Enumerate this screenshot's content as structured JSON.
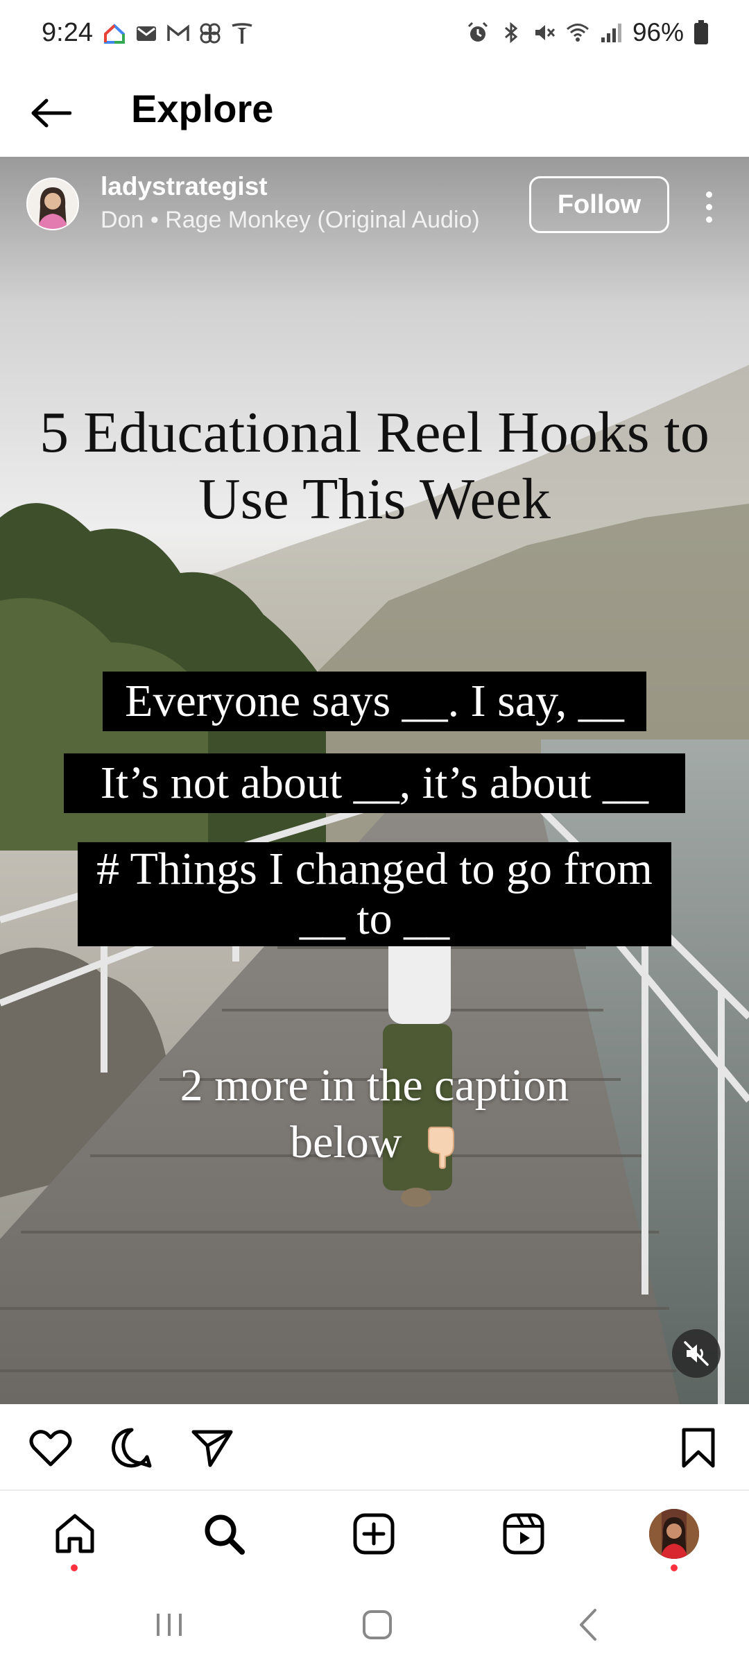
{
  "status_bar": {
    "time": "9:24",
    "battery": "96%",
    "left_icons": [
      "google-home-icon",
      "mail-icon",
      "gmail-icon",
      "pinwheel-icon",
      "tesla-icon"
    ],
    "right_icons": [
      "alarm-icon",
      "bluetooth-icon",
      "mute-icon",
      "wifi-icon",
      "signal-icon",
      "battery-icon"
    ]
  },
  "header": {
    "title": "Explore"
  },
  "post": {
    "username": "ladystrategist",
    "audio": "Don • Rage Monkey (Original Audio)",
    "follow_label": "Follow",
    "overlay_title": "5 Educational Reel Hooks to Use This Week",
    "hooks": [
      "Everyone says __. I say, __",
      "It’s not about __, it’s about __",
      "# Things I changed to go from __ to __"
    ],
    "caption_hint": "2 more in the caption below",
    "muted": true
  },
  "actions": [
    "like",
    "comment",
    "share",
    "save"
  ],
  "bottom_nav": {
    "items": [
      "home",
      "search",
      "create",
      "reels",
      "profile"
    ],
    "active": "search"
  },
  "colors": {
    "notification_dot": "#ff3040",
    "text": "#000000",
    "background": "#ffffff"
  }
}
